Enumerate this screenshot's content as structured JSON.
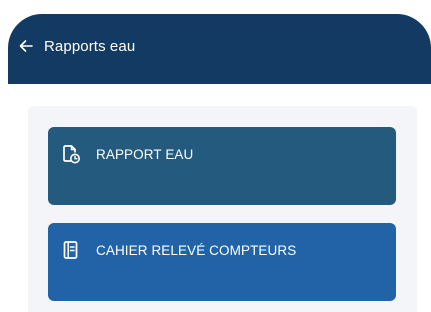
{
  "header": {
    "back_icon": "arrow-left-icon",
    "title": "Rapports eau",
    "background": "#133a62"
  },
  "menu": {
    "items": [
      {
        "icon": "document-clock-icon",
        "label": "RAPPORT EAU",
        "color": "#255a7f"
      },
      {
        "icon": "notebook-icon",
        "label": "CAHIER RELEVÉ COMPTEURS",
        "color": "#2263a8"
      }
    ]
  }
}
